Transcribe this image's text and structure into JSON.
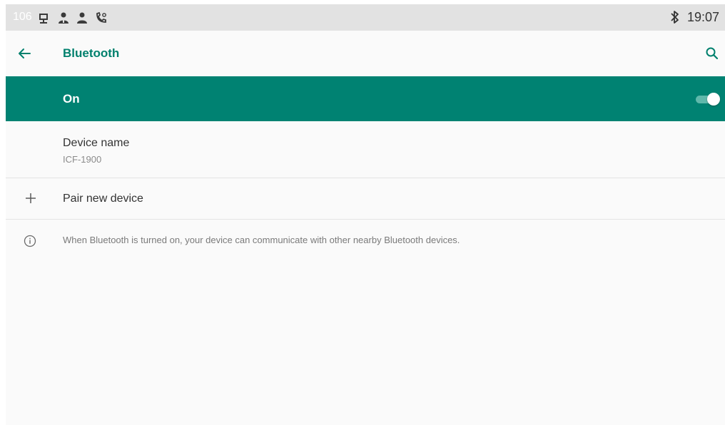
{
  "status_bar": {
    "extension": "106",
    "time": "19:07",
    "icons": [
      "network-icon",
      "contact-icon",
      "contact-icon",
      "voicemail-icon",
      "bluetooth-icon"
    ]
  },
  "toolbar": {
    "title": "Bluetooth",
    "back_icon": "arrow-back-icon",
    "search_icon": "search-icon"
  },
  "bluetooth_toggle": {
    "label": "On",
    "state": true
  },
  "device_name": {
    "label": "Device name",
    "value": "ICF-1900"
  },
  "pair": {
    "icon": "plus-icon",
    "label": "Pair new device"
  },
  "info": {
    "icon": "info-icon",
    "text": "When Bluetooth is turned on, your device can communicate with other nearby Bluetooth devices."
  },
  "colors": {
    "accent": "#008272",
    "title": "#00806d",
    "status_bar": "#e2e2e2",
    "background": "#fafafa",
    "switch_track": "#5fb8ab"
  }
}
